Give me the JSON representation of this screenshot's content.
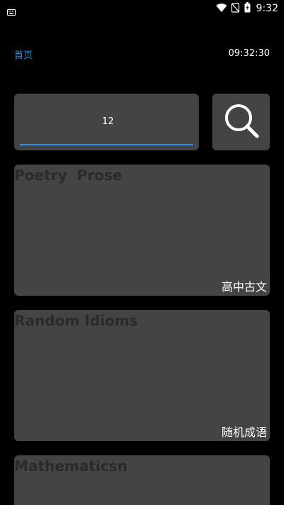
{
  "status_bar": {
    "time": "9:32",
    "icons": [
      "keyboard-icon",
      "wifi-icon",
      "signal-icon",
      "battery-icon"
    ]
  },
  "topbar": {
    "title": "首页",
    "time": "09:32:30"
  },
  "search": {
    "value": "12",
    "button_icon": "search-icon"
  },
  "cards": [
    {
      "en": "Poetry  Prose",
      "cn": "高中古文"
    },
    {
      "en": "Random Idioms",
      "cn": "随机成语"
    },
    {
      "en": "Mathematicsn",
      "cn": ""
    }
  ],
  "colors": {
    "background": "#000000",
    "card": "#444444",
    "accent": "#2d8ff0",
    "card_title": "#2a2a2a"
  }
}
